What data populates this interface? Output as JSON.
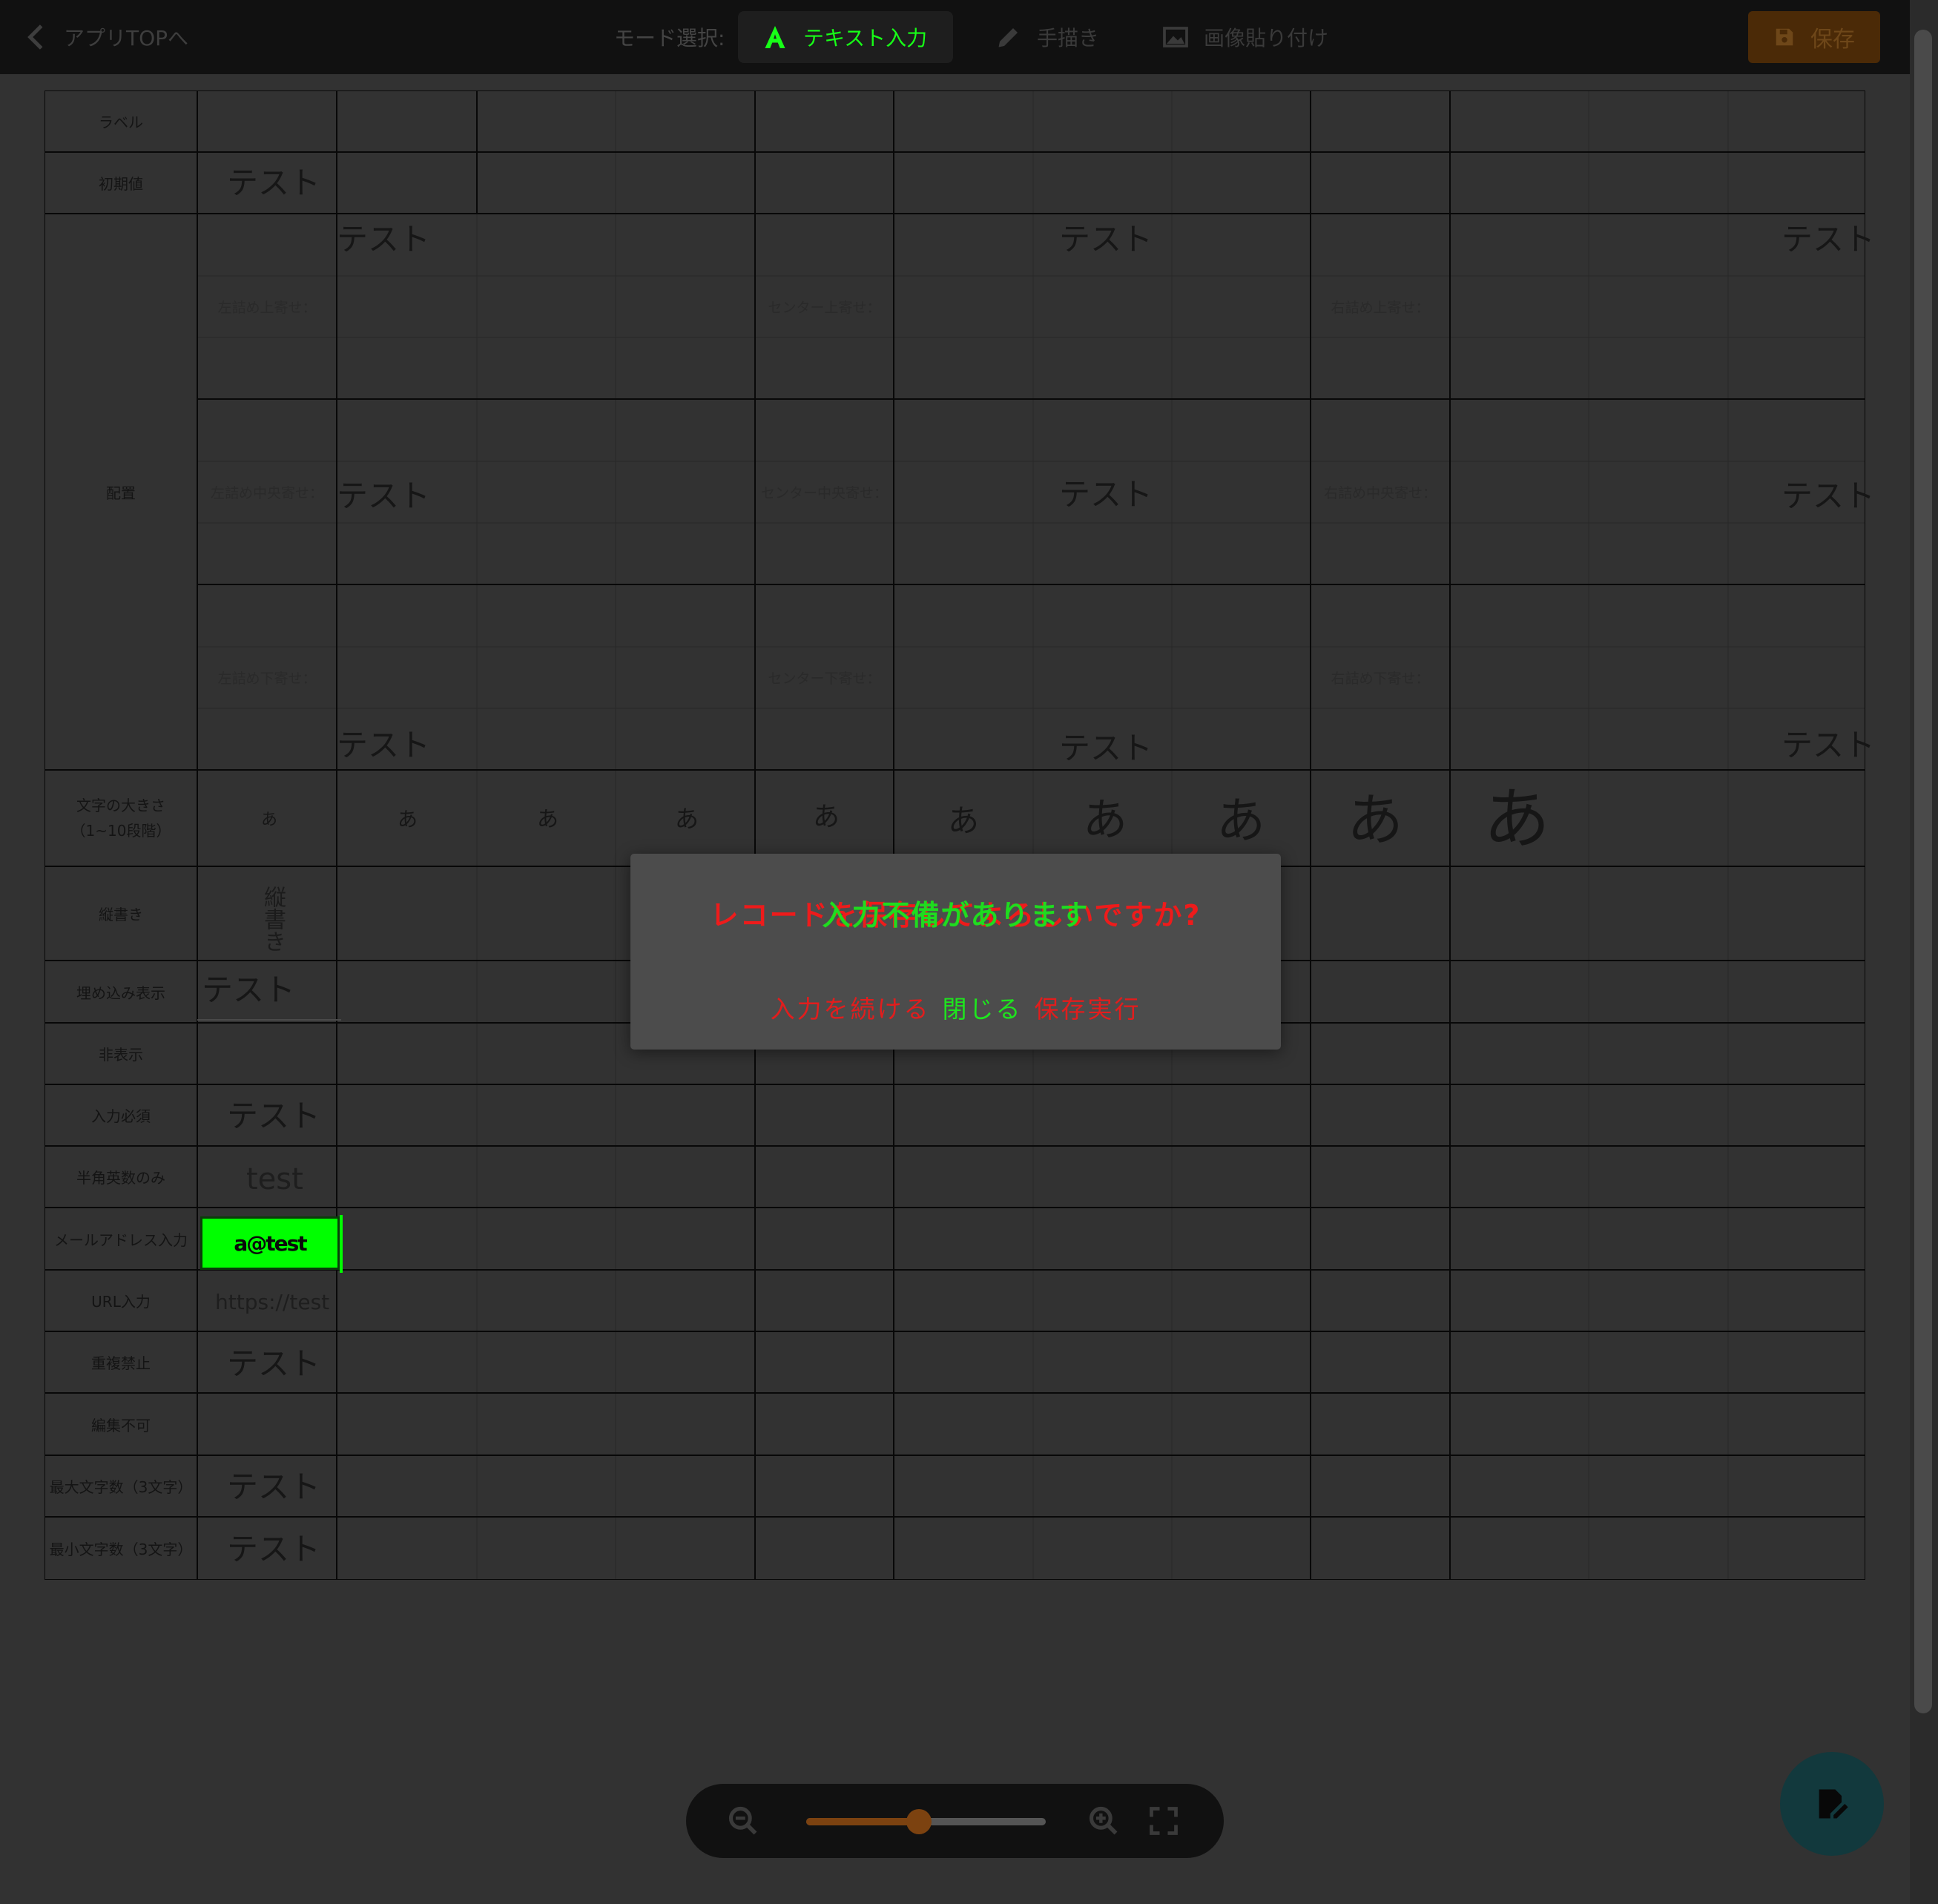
{
  "toolbar": {
    "back_label": "アプリTOPへ",
    "mode_label": "モード選択:",
    "modes": [
      {
        "label": "テキスト入力",
        "icon": "text-a-icon",
        "active": true
      },
      {
        "label": "手描き",
        "icon": "pencil-icon",
        "active": false
      },
      {
        "label": "画像貼り付け",
        "icon": "image-icon",
        "active": false
      }
    ],
    "save_label": "保存"
  },
  "rows": {
    "label": "ラベル",
    "initial": "初期値",
    "align": "配置",
    "font_size": "文字の大きさ\n（1~10段階）",
    "vertical": "縦書き",
    "embed": "埋め込み表示",
    "hidden": "非表示",
    "required": "入力必須",
    "halfwidth": "半角英数のみ",
    "email": "メールアドレス入力",
    "url": "URL入力",
    "no_dup": "重複禁止",
    "readonly": "編集不可",
    "max_len": "最大文字数（3文字）",
    "min_len": "最小文字数（3文字）"
  },
  "align_labels": {
    "left_top": "左詰め上寄せ：",
    "center_top": "センター上寄せ：",
    "right_top": "右詰め上寄せ：",
    "left_mid": "左詰め中央寄せ：",
    "center_mid": "センター中央寄せ：",
    "right_mid": "右詰め中央寄せ：",
    "left_bottom": "左詰め下寄せ：",
    "center_bottom": "センター下寄せ：",
    "right_bottom": "右詰め下寄せ："
  },
  "values": {
    "test": "テスト",
    "size_char": "あ",
    "vertical_text": "縦書き",
    "halfwidth_value": "test",
    "email_value": "a@test",
    "url_value": "https://test"
  },
  "modal": {
    "message": "レコードを保存してよろしいですか?",
    "message_overlay": "入力不備があります",
    "continue_label": "入力を続ける",
    "close_label": "閉じる",
    "save_label": "保存実行"
  },
  "zoom": {
    "level": 0.47
  },
  "colors": {
    "accent": "#00ff00",
    "alert": "#ee1b1b",
    "save": "#4b2a07"
  }
}
